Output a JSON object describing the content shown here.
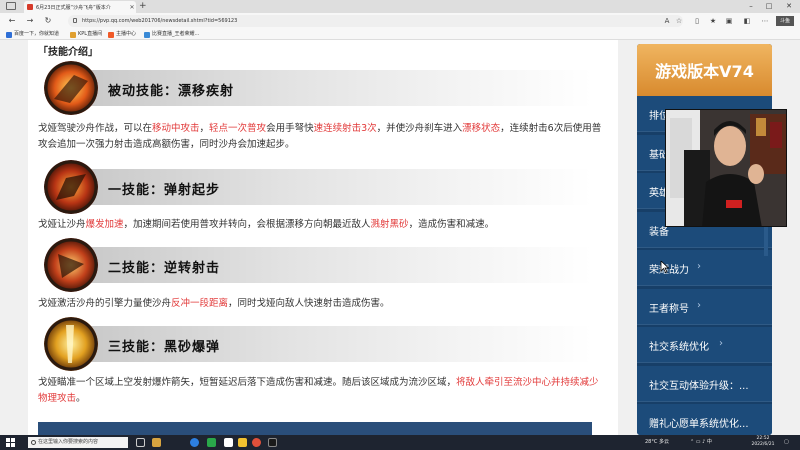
{
  "browser": {
    "tab_title": "6月23日正式服“沙舟飞舟”版本介",
    "url": "https://pvp.qq.com/web201706/newsdetail.shtml?tid=569123",
    "bookmarks": [
      "百度一下，你就知道",
      "KPL直播间",
      "主播中心",
      "比赛直播_王者荣耀..."
    ]
  },
  "page": {
    "section_header": "「技能介绍」",
    "skills": [
      {
        "title": "被动技能：漂移疾射",
        "desc": [
          {
            "t": "戈娅驾驶沙舟作战，可以在",
            "r": false
          },
          {
            "t": "移动中攻击",
            "r": true
          },
          {
            "t": "，",
            "r": false
          },
          {
            "t": "轻点一次普攻",
            "r": true
          },
          {
            "t": "会用手弩快",
            "r": false
          },
          {
            "t": "速连续射击3次",
            "r": true
          },
          {
            "t": "，并使沙舟刹车进入",
            "r": false
          },
          {
            "t": "漂移状态",
            "r": true
          },
          {
            "t": "，连续射击6次后使用普攻会追加一次强力射击造成高额伤害，同时沙舟会加速起步。",
            "r": false
          }
        ]
      },
      {
        "title": "一技能：弹射起步",
        "desc": [
          {
            "t": "戈娅让沙舟",
            "r": false
          },
          {
            "t": "爆发加速",
            "r": true
          },
          {
            "t": "，加速期间若使用普攻并转向，会根据漂移方向朝最近敌人",
            "r": false
          },
          {
            "t": "溅射黑砂",
            "r": true
          },
          {
            "t": "，造成伤害和减速。",
            "r": false
          }
        ]
      },
      {
        "title": "二技能：逆转射击",
        "desc": [
          {
            "t": "戈娅激活沙舟的引擎力量使沙舟",
            "r": false
          },
          {
            "t": "反冲一段距离",
            "r": true
          },
          {
            "t": "，同时戈娅向敌人快速射击造成伤害。",
            "r": false
          }
        ]
      },
      {
        "title": "三技能：黑砂爆弹",
        "desc": [
          {
            "t": "戈娅瞄准一个区域上空发射爆炸箭矢，短暂延迟后落下造成伤害和减速。随后该区域成为流沙区域，",
            "r": false
          },
          {
            "t": "将敌人牵引至流沙中心并持续减少物理攻击",
            "r": true
          },
          {
            "t": "。",
            "r": false
          }
        ]
      }
    ]
  },
  "sidebar": {
    "title": "游戏版本V74",
    "items": [
      {
        "label": "排位赛",
        "chevron": true
      },
      {
        "label": "基础",
        "chevron": false
      },
      {
        "label": "英雄",
        "chevron": false
      },
      {
        "label": "装备",
        "chevron": false
      },
      {
        "label": "荣耀战力",
        "chevron": true
      },
      {
        "label": "王者称号",
        "chevron": true
      },
      {
        "label": "社交系统优化",
        "chevron": true
      },
      {
        "label": "社交互动体验升级：...",
        "chevron": false
      },
      {
        "label": "赠礼心愿单系统优化...",
        "chevron": false
      }
    ]
  },
  "taskbar": {
    "search_placeholder": "在这里输入你要搜索的内容",
    "weather": "28°C 多云",
    "time": "22:52",
    "date": "2022/6/21"
  },
  "colors": {
    "accent_red": "#e23b3b",
    "sidebar_bg": "#173f68",
    "sidebar_top": "#e0983c"
  }
}
